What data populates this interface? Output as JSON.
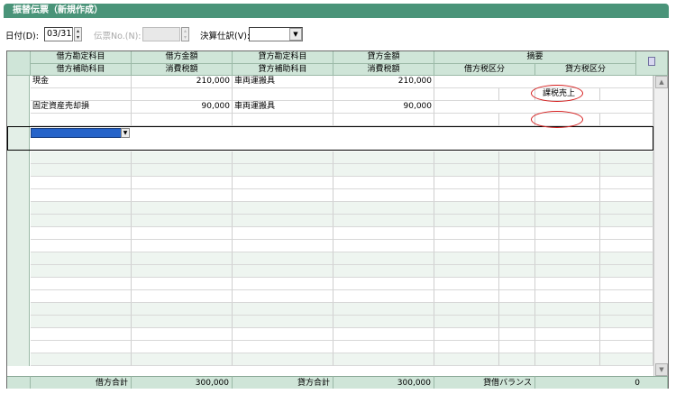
{
  "window": {
    "title": "振替伝票（新規作成）"
  },
  "toolbar": {
    "date_label": "日付(D):",
    "date_value": "03/31",
    "slip_label": "伝票No.(N):",
    "slip_value": "",
    "settle_label": "決算仕訳(V):",
    "settle_value": ""
  },
  "grid": {
    "header_row1": [
      "借方勘定科目",
      "借方金額",
      "貸方勘定科目",
      "貸方金額",
      "摘要"
    ],
    "header_row2": [
      "借方補助科目",
      "消費税額",
      "貸方補助科目",
      "消費税額",
      "借方税区分",
      "貸方税区分"
    ],
    "entries": [
      {
        "debit_account": "現金",
        "debit_amount": "210,000",
        "credit_account": "車両運搬具",
        "credit_amount": "210,000",
        "credit_tax": "課税売上"
      },
      {
        "debit_account": "固定資産売却損",
        "debit_amount": "90,000",
        "credit_account": "車両運搬具",
        "credit_amount": "90,000",
        "credit_tax": ""
      }
    ],
    "footer": {
      "debit_total_label": "借方合計",
      "debit_total": "300,000",
      "credit_total_label": "貸方合計",
      "credit_total": "300,000",
      "balance_label": "貸借バランス",
      "balance": "0"
    }
  },
  "colors": {
    "title_bar": "#4a9479",
    "header": "#cfe5d8",
    "annotation": "#d61e1e",
    "selection": "#2563c9"
  }
}
